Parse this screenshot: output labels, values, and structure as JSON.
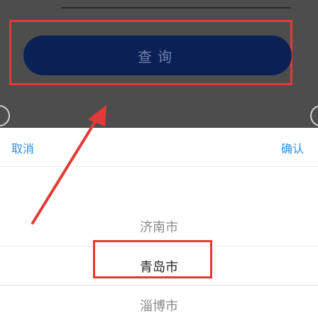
{
  "form": {
    "query_label": "查询"
  },
  "picker": {
    "cancel_label": "取消",
    "confirm_label": "确认",
    "options": [
      "济南市",
      "青岛市",
      "淄博市"
    ],
    "selected": "青岛市"
  },
  "colors": {
    "overlay": "#4d4d4d",
    "query_button": "#0b2156",
    "accent": "#2b8fe3",
    "annotation": "#e53935"
  }
}
